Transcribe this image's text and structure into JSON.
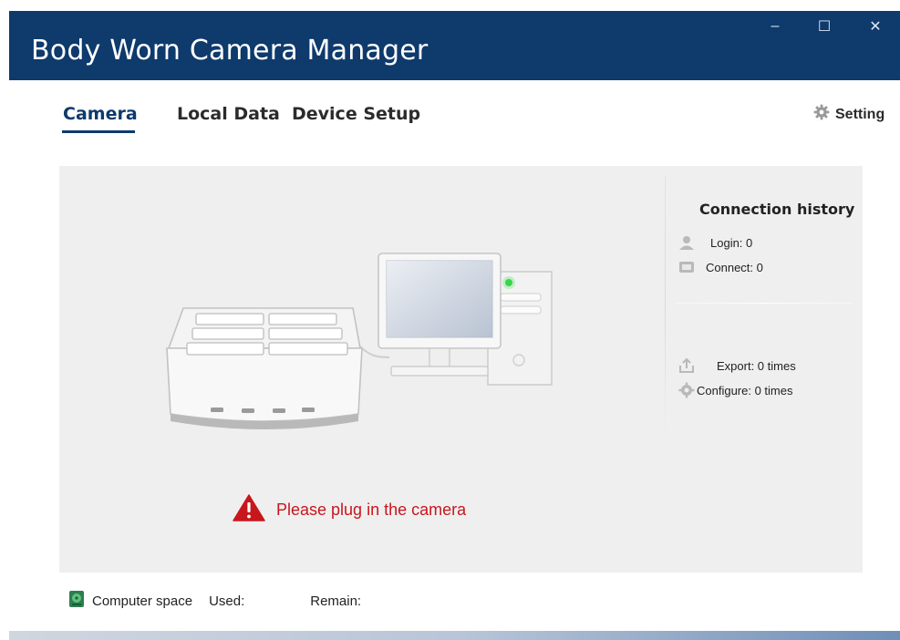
{
  "window": {
    "title": "Body Worn Camera Manager",
    "controls": {
      "minimize": "–",
      "maximize": "☐",
      "close": "✕"
    }
  },
  "nav": {
    "tabs": [
      {
        "label": "Camera",
        "active": true
      },
      {
        "label": "Local Data",
        "active": false
      },
      {
        "label": "Device Setup",
        "active": false
      }
    ],
    "setting_label": "Setting"
  },
  "connection_history": {
    "title": "Connection history",
    "login": "Login: 0",
    "connect": "Connect: 0",
    "export": "Export: 0 times",
    "configure": "Configure: 0 times"
  },
  "status": {
    "message": "Please plug in the camera",
    "color": "#c8161d"
  },
  "footer": {
    "computer_space": "Computer space",
    "used": "Used:",
    "remain": "Remain:"
  },
  "colors": {
    "accent": "#0e3a6c",
    "panel": "#efefef",
    "warning": "#c8161d"
  },
  "icons": [
    "gear-icon",
    "user-icon",
    "device-icon",
    "export-icon",
    "configure-icon",
    "warning-icon",
    "disk-icon"
  ]
}
